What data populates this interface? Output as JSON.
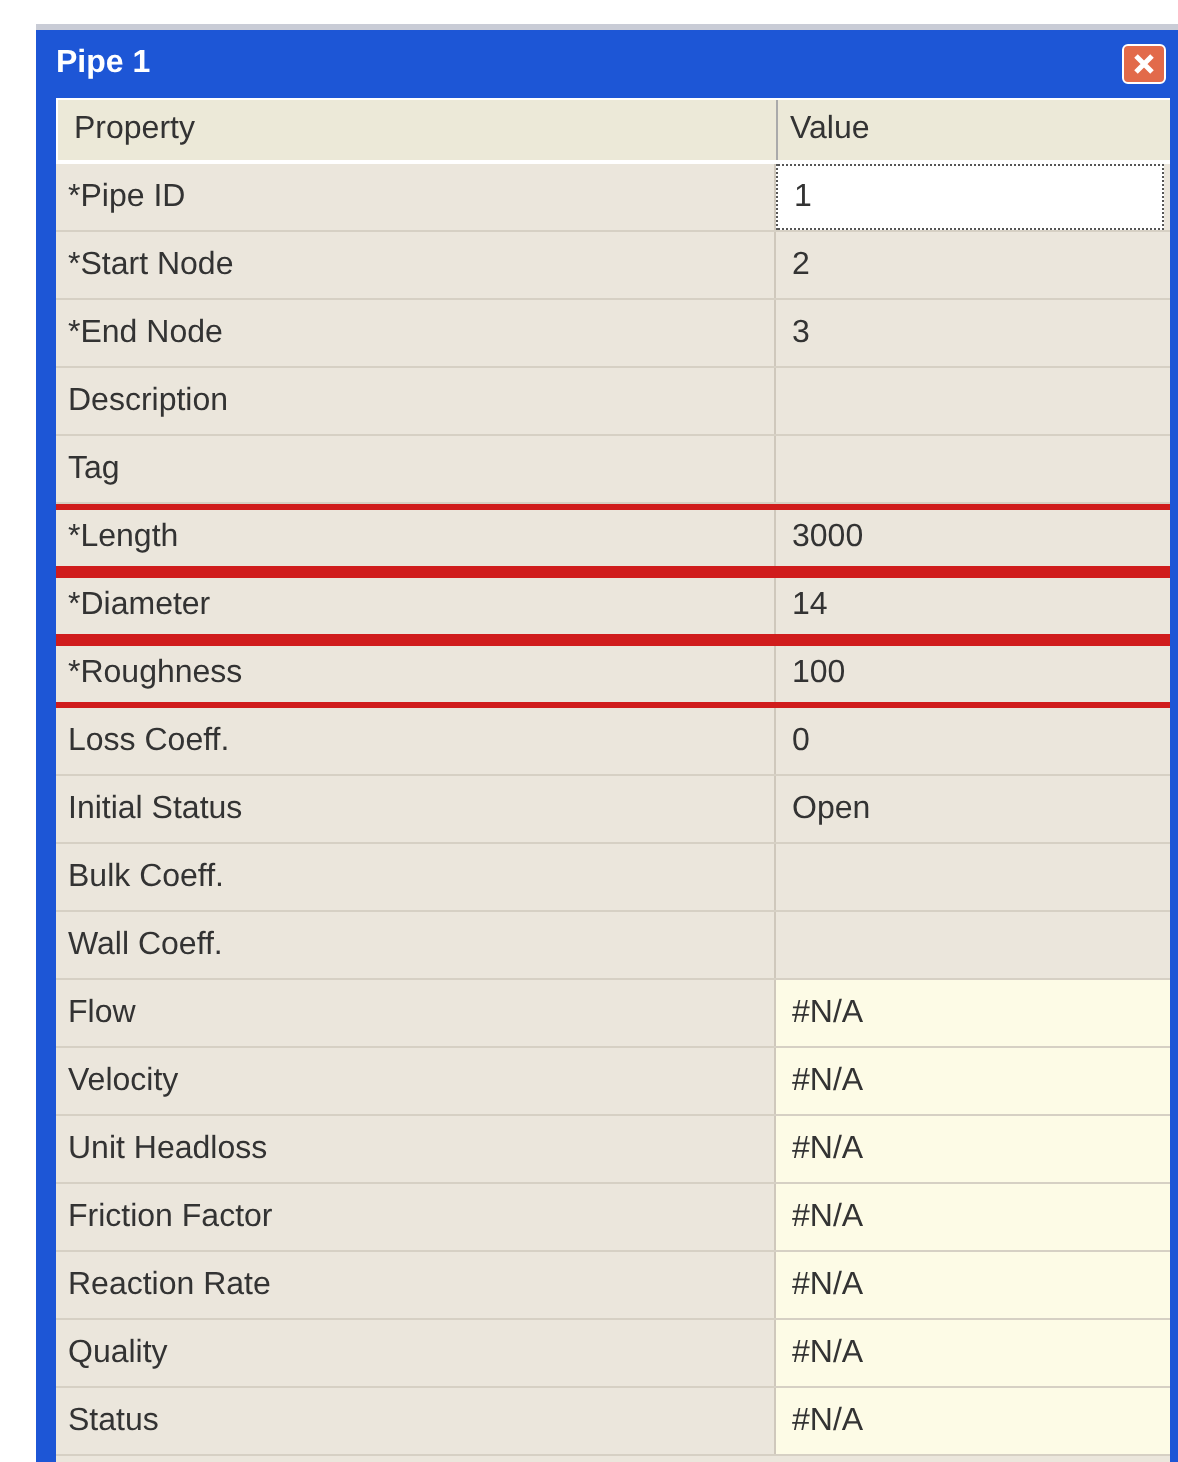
{
  "window": {
    "title": "Pipe 1"
  },
  "table": {
    "columns": [
      "Property",
      "Value"
    ],
    "rows": [
      {
        "property": "*Pipe ID",
        "value": "1",
        "selected": true,
        "highlighted": false,
        "readonly": false
      },
      {
        "property": "*Start Node",
        "value": "2",
        "selected": false,
        "highlighted": false,
        "readonly": false
      },
      {
        "property": "*End Node",
        "value": "3",
        "selected": false,
        "highlighted": false,
        "readonly": false
      },
      {
        "property": "Description",
        "selected": false,
        "highlighted": false,
        "readonly": false
      },
      {
        "property": "Tag",
        "selected": false,
        "highlighted": false,
        "readonly": false
      },
      {
        "property": "*Length",
        "value": "3000",
        "selected": false,
        "highlighted": true,
        "readonly": false
      },
      {
        "property": "*Diameter",
        "value": "14",
        "selected": false,
        "highlighted": true,
        "readonly": false
      },
      {
        "property": "*Roughness",
        "value": "100",
        "selected": false,
        "highlighted": true,
        "readonly": false
      },
      {
        "property": "Loss Coeff.",
        "value": "0",
        "selected": false,
        "highlighted": false,
        "readonly": false
      },
      {
        "property": "Initial Status",
        "value": "Open",
        "selected": false,
        "highlighted": false,
        "readonly": false
      },
      {
        "property": "Bulk Coeff.",
        "selected": false,
        "highlighted": false,
        "readonly": false
      },
      {
        "property": "Wall Coeff.",
        "selected": false,
        "highlighted": false,
        "readonly": false
      },
      {
        "property": "Flow",
        "value": "#N/A",
        "selected": false,
        "highlighted": false,
        "readonly": true
      },
      {
        "property": "Velocity",
        "value": "#N/A",
        "selected": false,
        "highlighted": false,
        "readonly": true
      },
      {
        "property": "Unit Headloss",
        "value": "#N/A",
        "selected": false,
        "highlighted": false,
        "readonly": true
      },
      {
        "property": "Friction Factor",
        "value": "#N/A",
        "selected": false,
        "highlighted": false,
        "readonly": true
      },
      {
        "property": "Reaction Rate",
        "value": "#N/A",
        "selected": false,
        "highlighted": false,
        "readonly": true
      },
      {
        "property": "Quality",
        "value": "#N/A",
        "selected": false,
        "highlighted": false,
        "readonly": true
      },
      {
        "property": "Status",
        "value": "#N/A",
        "selected": false,
        "highlighted": false,
        "readonly": true
      }
    ]
  }
}
